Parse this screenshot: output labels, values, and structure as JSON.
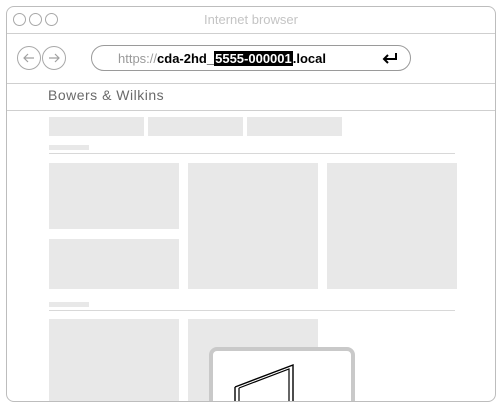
{
  "window": {
    "title": "Internet browser"
  },
  "address_bar": {
    "scheme": "https://",
    "host": "cda-2hd_",
    "selected": "5555-000001",
    "suffix": ".local"
  },
  "site": {
    "brand": "Bowers & Wilkins"
  },
  "icons": {
    "back": "back-arrow-icon",
    "forward": "forward-arrow-icon",
    "enter": "enter-return-icon"
  }
}
